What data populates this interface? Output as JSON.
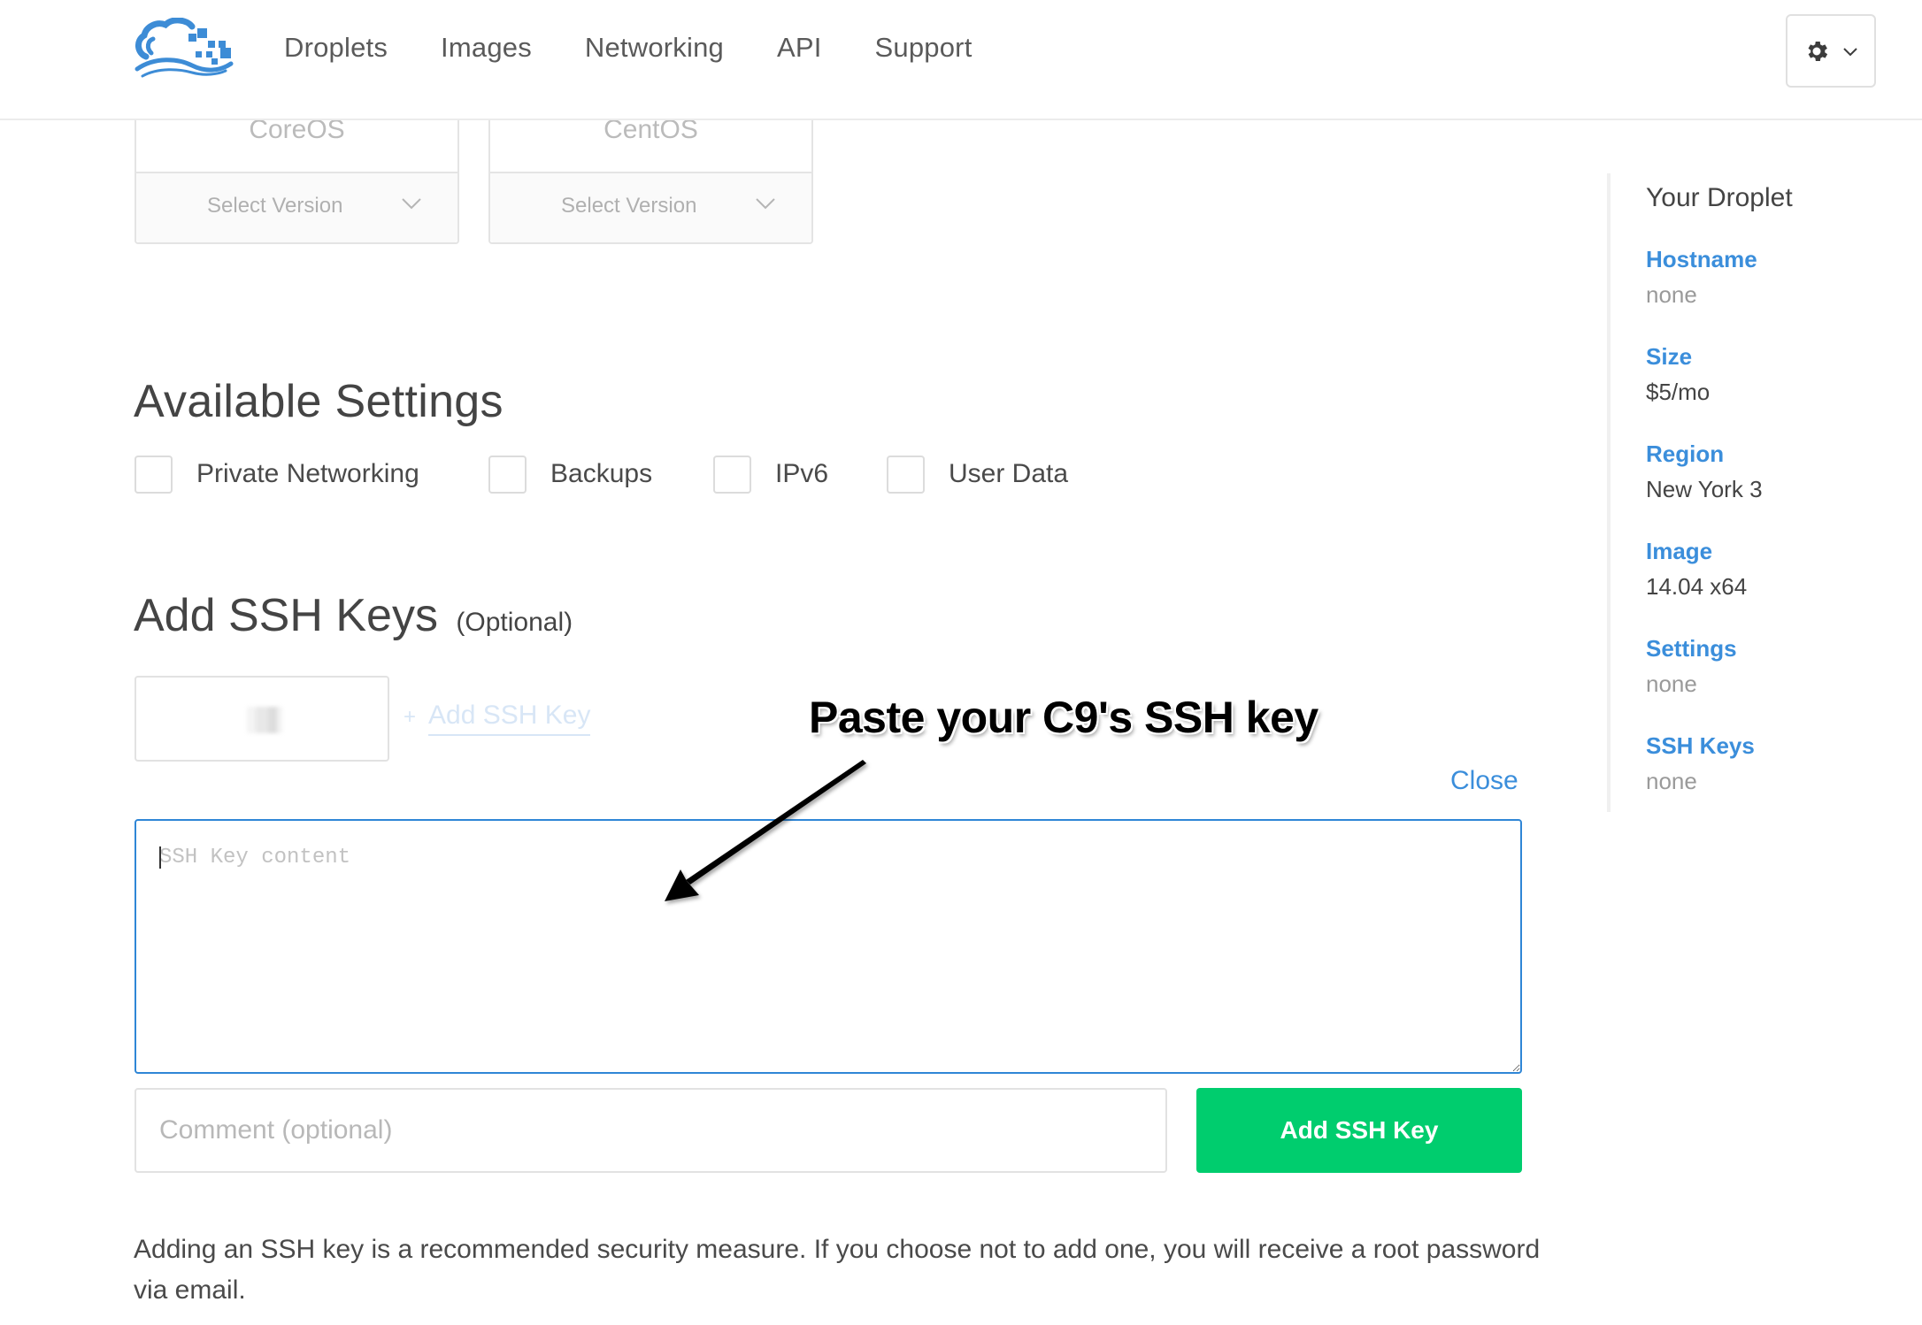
{
  "header": {
    "logo_icon": "digitalocean-cloud-logo",
    "nav": [
      {
        "label": "Droplets"
      },
      {
        "label": "Images"
      },
      {
        "label": "Networking"
      },
      {
        "label": "API"
      },
      {
        "label": "Support"
      }
    ],
    "settings_menu_icon": "gear-icon"
  },
  "distributions": [
    {
      "name": "CoreOS",
      "select_label": "Select Version"
    },
    {
      "name": "CentOS",
      "select_label": "Select Version"
    }
  ],
  "available_settings": {
    "title": "Available Settings",
    "options": [
      {
        "label": "Private Networking",
        "checked": false
      },
      {
        "label": "Backups",
        "checked": false
      },
      {
        "label": "IPv6",
        "checked": false
      },
      {
        "label": "User Data",
        "checked": false
      }
    ]
  },
  "ssh_keys": {
    "title": "Add SSH Keys",
    "title_suffix": "(Optional)",
    "add_link_plus": "+",
    "add_link_label": "Add SSH Key",
    "close_label": "Close",
    "textarea_placeholder": "SSH Key content",
    "textarea_value": "",
    "comment_placeholder": "Comment (optional)",
    "comment_value": "",
    "submit_label": "Add SSH Key",
    "help_text": "Adding an SSH key is a recommended security measure. If you choose not to add one, you will receive a root password via email."
  },
  "annotation": {
    "text": "Paste your C9's SSH key"
  },
  "sidebar": {
    "title": "Your Droplet",
    "items": [
      {
        "label": "Hostname",
        "value": "none",
        "muted": true
      },
      {
        "label": "Size",
        "value": "$5/mo",
        "muted": false
      },
      {
        "label": "Region",
        "value": "New York 3",
        "muted": false
      },
      {
        "label": "Image",
        "value": "14.04 x64",
        "muted": false
      },
      {
        "label": "Settings",
        "value": "none",
        "muted": true
      },
      {
        "label": "SSH Keys",
        "value": "none",
        "muted": true
      }
    ]
  },
  "colors": {
    "accent_blue": "#3b8edb",
    "primary_green": "#00cd6e",
    "focus_border": "#2f86d6"
  }
}
